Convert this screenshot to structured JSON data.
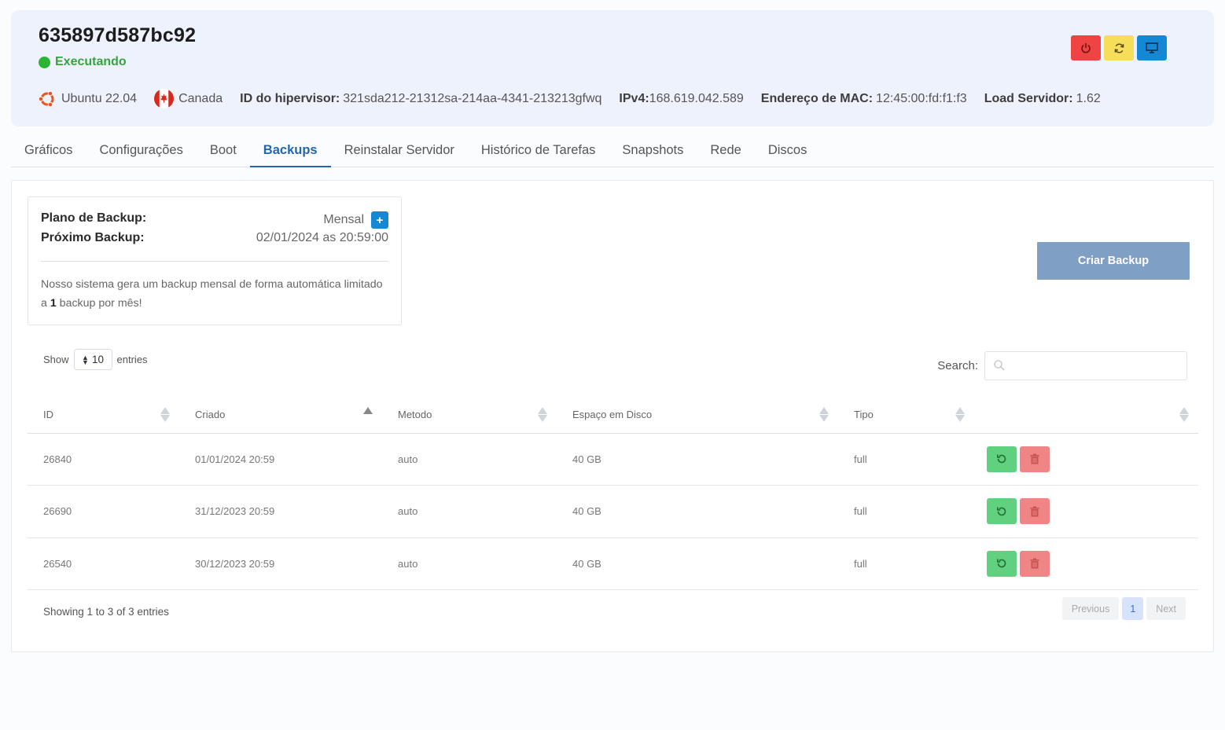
{
  "header": {
    "server_name": "635897d587bc92",
    "status": "Executando",
    "os": "Ubuntu 22.04",
    "location": "Canada",
    "hypervisor_label": "ID do hipervisor:",
    "hypervisor_value": "321sda212-21312sa-214aa-4341-213213gfwq",
    "ipv4_label": "IPv4:",
    "ipv4_value": "168.619.042.589",
    "mac_label": "Endereço de MAC:",
    "mac_value": "12:45:00:fd:f1:f3",
    "load_label": "Load Servidor:",
    "load_value": "1.62"
  },
  "tabs": [
    "Gráficos",
    "Configurações",
    "Boot",
    "Backups",
    "Reinstalar Servidor",
    "Histórico de Tarefas",
    "Snapshots",
    "Rede",
    "Discos"
  ],
  "plan": {
    "plan_label": "Plano de Backup:",
    "plan_value": "Mensal",
    "plus": "+",
    "next_label": "Próximo Backup:",
    "next_value": "02/01/2024 as 20:59:00",
    "desc_before": "Nosso sistema gera um backup mensal de forma automática limitado a ",
    "desc_bold": "1",
    "desc_after": " backup por mês!"
  },
  "create_button": "Criar Backup",
  "table_controls": {
    "show": "Show",
    "length": "10",
    "entries": "entries",
    "search_label": "Search:"
  },
  "columns": [
    "ID",
    "Criado",
    "Metodo",
    "Espaço em Disco",
    "Tipo",
    ""
  ],
  "rows": [
    {
      "id": "26840",
      "created": "01/01/2024 20:59",
      "method": "auto",
      "space": "40 GB",
      "type": "full"
    },
    {
      "id": "26690",
      "created": "31/12/2023 20:59",
      "method": "auto",
      "space": "40 GB",
      "type": "full"
    },
    {
      "id": "26540",
      "created": "30/12/2023 20:59",
      "method": "auto",
      "space": "40 GB",
      "type": "full"
    }
  ],
  "footer": {
    "info": "Showing 1 to 3 of 3 entries",
    "previous": "Previous",
    "page": "1",
    "next": "Next"
  },
  "colors": {
    "status_green": "#2bb334",
    "power_red": "#ee4444",
    "restart_yellow": "#f6de5a",
    "console_blue": "#1488d4",
    "active_tab": "#2366b0",
    "create_button": "#7f9fc4",
    "restore_green": "#62d17f",
    "delete_red": "#f08585"
  }
}
